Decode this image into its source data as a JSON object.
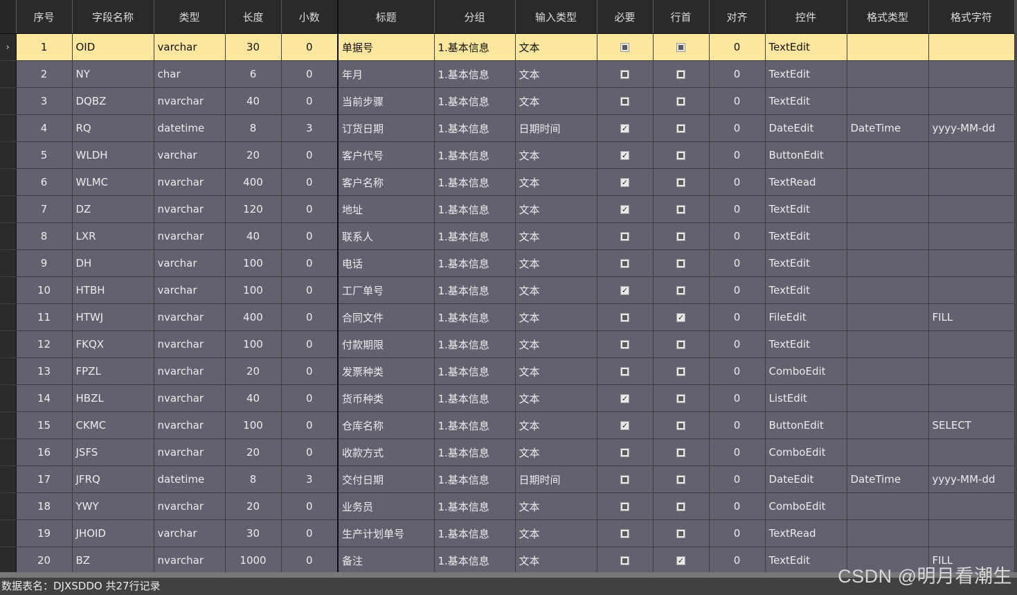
{
  "grid": {
    "columns": [
      "序号",
      "字段名称",
      "类型",
      "长度",
      "小数",
      "标题",
      "分组",
      "输入类型",
      "必要",
      "行首",
      "对齐",
      "控件",
      "格式类型",
      "格式字符"
    ],
    "selected_indicator": "›",
    "rows": [
      {
        "seq": "1",
        "field": "OID",
        "type": "varchar",
        "length": "30",
        "decimal": "0",
        "title": "单据号",
        "group": "1.基本信息",
        "input_type": "文本",
        "required": false,
        "row_head": false,
        "align": "0",
        "control": "TextEdit",
        "format_type": "",
        "format_str": "",
        "selected": true
      },
      {
        "seq": "2",
        "field": "NY",
        "type": "char",
        "length": "6",
        "decimal": "0",
        "title": "年月",
        "group": "1.基本信息",
        "input_type": "文本",
        "required": false,
        "row_head": false,
        "align": "0",
        "control": "TextEdit",
        "format_type": "",
        "format_str": ""
      },
      {
        "seq": "3",
        "field": "DQBZ",
        "type": "nvarchar",
        "length": "40",
        "decimal": "0",
        "title": "当前步骤",
        "group": "1.基本信息",
        "input_type": "文本",
        "required": false,
        "row_head": false,
        "align": "0",
        "control": "TextEdit",
        "format_type": "",
        "format_str": ""
      },
      {
        "seq": "4",
        "field": "RQ",
        "type": "datetime",
        "length": "8",
        "decimal": "3",
        "title": "订货日期",
        "group": "1.基本信息",
        "input_type": "日期时间",
        "required": true,
        "row_head": false,
        "align": "0",
        "control": "DateEdit",
        "format_type": "DateTime",
        "format_str": "yyyy-MM-dd"
      },
      {
        "seq": "5",
        "field": "WLDH",
        "type": "varchar",
        "length": "20",
        "decimal": "0",
        "title": "客户代号",
        "group": "1.基本信息",
        "input_type": "文本",
        "required": true,
        "row_head": false,
        "align": "0",
        "control": "ButtonEdit",
        "format_type": "",
        "format_str": ""
      },
      {
        "seq": "6",
        "field": "WLMC",
        "type": "nvarchar",
        "length": "400",
        "decimal": "0",
        "title": "客户名称",
        "group": "1.基本信息",
        "input_type": "文本",
        "required": true,
        "row_head": false,
        "align": "0",
        "control": "TextRead",
        "format_type": "",
        "format_str": ""
      },
      {
        "seq": "7",
        "field": "DZ",
        "type": "nvarchar",
        "length": "120",
        "decimal": "0",
        "title": "地址",
        "group": "1.基本信息",
        "input_type": "文本",
        "required": true,
        "row_head": false,
        "align": "0",
        "control": "TextEdit",
        "format_type": "",
        "format_str": ""
      },
      {
        "seq": "8",
        "field": "LXR",
        "type": "nvarchar",
        "length": "40",
        "decimal": "0",
        "title": "联系人",
        "group": "1.基本信息",
        "input_type": "文本",
        "required": false,
        "row_head": false,
        "align": "0",
        "control": "TextEdit",
        "format_type": "",
        "format_str": ""
      },
      {
        "seq": "9",
        "field": "DH",
        "type": "varchar",
        "length": "100",
        "decimal": "0",
        "title": "电话",
        "group": "1.基本信息",
        "input_type": "文本",
        "required": false,
        "row_head": false,
        "align": "0",
        "control": "TextEdit",
        "format_type": "",
        "format_str": ""
      },
      {
        "seq": "10",
        "field": "HTBH",
        "type": "varchar",
        "length": "100",
        "decimal": "0",
        "title": "工厂单号",
        "group": "1.基本信息",
        "input_type": "文本",
        "required": true,
        "row_head": false,
        "align": "0",
        "control": "TextEdit",
        "format_type": "",
        "format_str": ""
      },
      {
        "seq": "11",
        "field": "HTWJ",
        "type": "nvarchar",
        "length": "400",
        "decimal": "0",
        "title": "合同文件",
        "group": "1.基本信息",
        "input_type": "文本",
        "required": false,
        "row_head": true,
        "align": "0",
        "control": "FileEdit",
        "format_type": "",
        "format_str": "FILL"
      },
      {
        "seq": "12",
        "field": "FKQX",
        "type": "nvarchar",
        "length": "100",
        "decimal": "0",
        "title": "付款期限",
        "group": "1.基本信息",
        "input_type": "文本",
        "required": false,
        "row_head": false,
        "align": "0",
        "control": "TextEdit",
        "format_type": "",
        "format_str": ""
      },
      {
        "seq": "13",
        "field": "FPZL",
        "type": "nvarchar",
        "length": "20",
        "decimal": "0",
        "title": "发票种类",
        "group": "1.基本信息",
        "input_type": "文本",
        "required": false,
        "row_head": false,
        "align": "0",
        "control": "ComboEdit",
        "format_type": "",
        "format_str": ""
      },
      {
        "seq": "14",
        "field": "HBZL",
        "type": "nvarchar",
        "length": "40",
        "decimal": "0",
        "title": "货币种类",
        "group": "1.基本信息",
        "input_type": "文本",
        "required": true,
        "row_head": false,
        "align": "0",
        "control": "ListEdit",
        "format_type": "",
        "format_str": ""
      },
      {
        "seq": "15",
        "field": "CKMC",
        "type": "nvarchar",
        "length": "100",
        "decimal": "0",
        "title": "仓库名称",
        "group": "1.基本信息",
        "input_type": "文本",
        "required": true,
        "row_head": false,
        "align": "0",
        "control": "ButtonEdit",
        "format_type": "",
        "format_str": "SELECT"
      },
      {
        "seq": "16",
        "field": "JSFS",
        "type": "nvarchar",
        "length": "20",
        "decimal": "0",
        "title": "收款方式",
        "group": "1.基本信息",
        "input_type": "文本",
        "required": false,
        "row_head": false,
        "align": "0",
        "control": "ComboEdit",
        "format_type": "",
        "format_str": ""
      },
      {
        "seq": "17",
        "field": "JFRQ",
        "type": "datetime",
        "length": "8",
        "decimal": "3",
        "title": "交付日期",
        "group": "1.基本信息",
        "input_type": "日期时间",
        "required": false,
        "row_head": false,
        "align": "0",
        "control": "DateEdit",
        "format_type": "DateTime",
        "format_str": "yyyy-MM-dd"
      },
      {
        "seq": "18",
        "field": "YWY",
        "type": "nvarchar",
        "length": "20",
        "decimal": "0",
        "title": "业务员",
        "group": "1.基本信息",
        "input_type": "文本",
        "required": false,
        "row_head": false,
        "align": "0",
        "control": "ComboEdit",
        "format_type": "",
        "format_str": ""
      },
      {
        "seq": "19",
        "field": "JHOID",
        "type": "varchar",
        "length": "30",
        "decimal": "0",
        "title": "生产计划单号",
        "group": "1.基本信息",
        "input_type": "文本",
        "required": false,
        "row_head": false,
        "align": "0",
        "control": "TextRead",
        "format_type": "",
        "format_str": ""
      },
      {
        "seq": "20",
        "field": "BZ",
        "type": "nvarchar",
        "length": "1000",
        "decimal": "0",
        "title": "备注",
        "group": "1.基本信息",
        "input_type": "文本",
        "required": false,
        "row_head": true,
        "align": "0",
        "control": "TextEdit",
        "format_type": "",
        "format_str": "FILL"
      }
    ]
  },
  "status_bar": {
    "text": "数据表名：DJXSDDO 共27行记录"
  },
  "watermark": "CSDN @明月看潮生",
  "colors": {
    "row_bg": "#636070",
    "selected_row_bg": "#fde79e",
    "header_bg": "#2a2a2a"
  }
}
